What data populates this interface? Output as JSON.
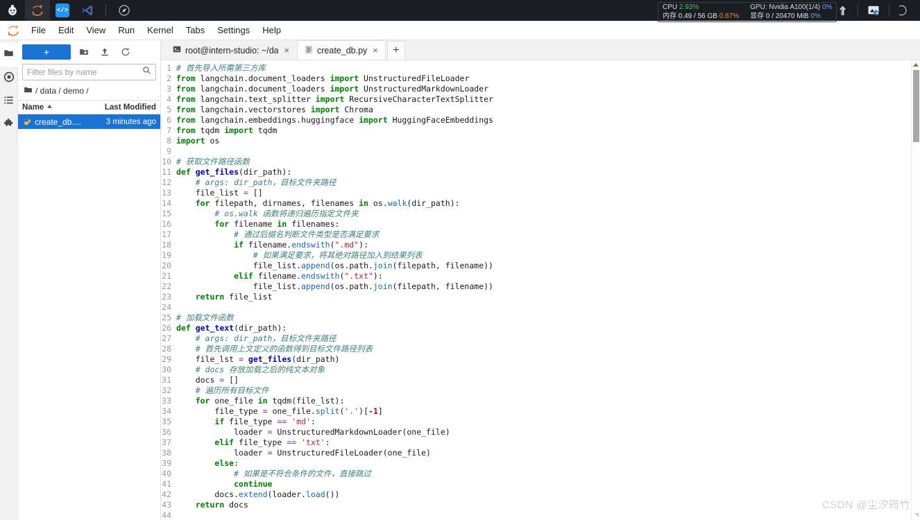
{
  "topbar": {
    "apps": [
      {
        "name": "studio-logo-icon",
        "label": ""
      },
      {
        "name": "jupyter-app-icon",
        "label": ""
      },
      {
        "name": "code-app-icon",
        "label": "</>"
      },
      {
        "name": "vscode-app-icon",
        "label": ""
      },
      {
        "name": "compass-app-icon",
        "label": ""
      }
    ],
    "stats": {
      "cpu_label": "CPU",
      "cpu_value": "2.93%",
      "mem_label": "内存",
      "mem_value": "0.49 / 56 GB",
      "mem_pct": "0.87%",
      "gpu_label": "GPU: Nvidia A100(1/4)",
      "gpu_pct": "0%",
      "vram_label": "显存",
      "vram_value": "0 / 20470 MiB",
      "vram_pct": "0%"
    },
    "right_icons": [
      {
        "name": "upload-arrow-icon"
      },
      {
        "name": "image-share-icon"
      },
      {
        "name": "more-icon"
      }
    ],
    "colors": {
      "background": "#1b1d23",
      "green": "#49c46a",
      "orange": "#e8923a",
      "blue": "#5aa9f0"
    }
  },
  "menubar": {
    "logo_name": "jupyter-logo-icon",
    "items": [
      {
        "label": "File"
      },
      {
        "label": "Edit"
      },
      {
        "label": "View"
      },
      {
        "label": "Run"
      },
      {
        "label": "Kernel"
      },
      {
        "label": "Tabs"
      },
      {
        "label": "Settings"
      },
      {
        "label": "Help"
      }
    ]
  },
  "rail": {
    "items": [
      {
        "name": "sidebar-item-file-browser",
        "icon": "folder-icon",
        "active": true
      },
      {
        "name": "sidebar-item-running",
        "icon": "running-stop-icon",
        "active": false
      },
      {
        "name": "sidebar-item-commands",
        "icon": "list-icon",
        "active": false
      },
      {
        "name": "sidebar-item-extensions",
        "icon": "puzzle-icon",
        "active": false
      }
    ]
  },
  "filebrowser": {
    "new_button_label": "+",
    "toolbar_icons": [
      {
        "name": "new-folder-icon"
      },
      {
        "name": "upload-icon"
      },
      {
        "name": "refresh-icon"
      }
    ],
    "filter_placeholder": "Filter files by name",
    "filter_value": "",
    "search_icon": "search-icon",
    "breadcrumb": "/ data / demo /",
    "breadcrumb_icon": "folder-icon",
    "columns": {
      "name": "Name",
      "modified": "Last Modified",
      "sort_icon": "sort-asc-icon"
    },
    "rows": [
      {
        "icon": "python-file-icon",
        "name": "create_db....",
        "modified": "3 minutes ago",
        "selected": true
      }
    ]
  },
  "tabbar": {
    "tabs": [
      {
        "label": "root@intern-studio: ~/dat",
        "icon": "terminal-icon",
        "active": false,
        "close": "×"
      },
      {
        "label": "create_db.py",
        "icon": "text-file-icon",
        "active": true,
        "close": "×"
      }
    ],
    "add_label": "+"
  },
  "editor": {
    "scrollbar": {
      "name": "vertical-scrollbar"
    },
    "lines": [
      {
        "n": 1,
        "tokens": [
          {
            "t": "# 首先导入所需第三方库",
            "c": "cm"
          }
        ]
      },
      {
        "n": 2,
        "tokens": [
          {
            "t": "from",
            "c": "k"
          },
          {
            "t": " langchain.document_loaders "
          },
          {
            "t": "import",
            "c": "k"
          },
          {
            "t": " UnstructuredFileLoader"
          }
        ]
      },
      {
        "n": 3,
        "tokens": [
          {
            "t": "from",
            "c": "k"
          },
          {
            "t": " langchain.document_loaders "
          },
          {
            "t": "import",
            "c": "k"
          },
          {
            "t": " UnstructuredMarkdownLoader"
          }
        ]
      },
      {
        "n": 4,
        "tokens": [
          {
            "t": "from",
            "c": "k"
          },
          {
            "t": " langchain.text_splitter "
          },
          {
            "t": "import",
            "c": "k"
          },
          {
            "t": " RecursiveCharacterTextSplitter"
          }
        ]
      },
      {
        "n": 5,
        "tokens": [
          {
            "t": "from",
            "c": "k"
          },
          {
            "t": " langchain.vectorstores "
          },
          {
            "t": "import",
            "c": "k"
          },
          {
            "t": " Chroma"
          }
        ]
      },
      {
        "n": 6,
        "tokens": [
          {
            "t": "from",
            "c": "k"
          },
          {
            "t": " langchain.embeddings.huggingface "
          },
          {
            "t": "import",
            "c": "k"
          },
          {
            "t": " HuggingFaceEmbeddings"
          }
        ]
      },
      {
        "n": 7,
        "tokens": [
          {
            "t": "from",
            "c": "k"
          },
          {
            "t": " tqdm "
          },
          {
            "t": "import",
            "c": "k"
          },
          {
            "t": " tqdm"
          }
        ]
      },
      {
        "n": 8,
        "tokens": [
          {
            "t": "import",
            "c": "k"
          },
          {
            "t": " os"
          }
        ]
      },
      {
        "n": 9,
        "tokens": []
      },
      {
        "n": 10,
        "tokens": [
          {
            "t": "# 获取文件路径函数",
            "c": "cm"
          }
        ]
      },
      {
        "n": 11,
        "tokens": [
          {
            "t": "def",
            "c": "k"
          },
          {
            "t": " "
          },
          {
            "t": "get_files",
            "c": "fn"
          },
          {
            "t": "(dir_path):"
          }
        ]
      },
      {
        "n": 12,
        "tokens": [
          {
            "t": "    # args: dir_path，目标文件夹路径",
            "c": "cm"
          }
        ]
      },
      {
        "n": 13,
        "tokens": [
          {
            "t": "    file_list "
          },
          {
            "t": "=",
            "c": "op"
          },
          {
            "t": " []"
          }
        ]
      },
      {
        "n": 14,
        "tokens": [
          {
            "t": "    "
          },
          {
            "t": "for",
            "c": "k"
          },
          {
            "t": " filepath, dirnames, filenames "
          },
          {
            "t": "in",
            "c": "k"
          },
          {
            "t": " os."
          },
          {
            "t": "walk",
            "c": "mt"
          },
          {
            "t": "(dir_path):"
          }
        ]
      },
      {
        "n": 15,
        "tokens": [
          {
            "t": "        # os.walk 函数将递归遍历指定文件夹",
            "c": "cm"
          }
        ]
      },
      {
        "n": 16,
        "tokens": [
          {
            "t": "        "
          },
          {
            "t": "for",
            "c": "k"
          },
          {
            "t": " filename "
          },
          {
            "t": "in",
            "c": "k"
          },
          {
            "t": " filenames:"
          }
        ]
      },
      {
        "n": 17,
        "tokens": [
          {
            "t": "            # 通过后缀名判断文件类型是否满足要求",
            "c": "cm"
          }
        ]
      },
      {
        "n": 18,
        "tokens": [
          {
            "t": "            "
          },
          {
            "t": "if",
            "c": "k"
          },
          {
            "t": " filename."
          },
          {
            "t": "endswith",
            "c": "mt"
          },
          {
            "t": "("
          },
          {
            "t": "\".md\"",
            "c": "st"
          },
          {
            "t": "):"
          }
        ]
      },
      {
        "n": 19,
        "tokens": [
          {
            "t": "                # 如果满足要求，将其绝对路径加入到结果列表",
            "c": "cm"
          }
        ]
      },
      {
        "n": 20,
        "tokens": [
          {
            "t": "                file_list."
          },
          {
            "t": "append",
            "c": "mt"
          },
          {
            "t": "(os.path."
          },
          {
            "t": "join",
            "c": "mt"
          },
          {
            "t": "(filepath, filename))"
          }
        ]
      },
      {
        "n": 21,
        "tokens": [
          {
            "t": "            "
          },
          {
            "t": "elif",
            "c": "k"
          },
          {
            "t": " filename."
          },
          {
            "t": "endswith",
            "c": "mt"
          },
          {
            "t": "("
          },
          {
            "t": "\".txt\"",
            "c": "st"
          },
          {
            "t": "):"
          }
        ]
      },
      {
        "n": 22,
        "tokens": [
          {
            "t": "                file_list."
          },
          {
            "t": "append",
            "c": "mt"
          },
          {
            "t": "(os.path."
          },
          {
            "t": "join",
            "c": "mt"
          },
          {
            "t": "(filepath, filename))"
          }
        ]
      },
      {
        "n": 23,
        "tokens": [
          {
            "t": "    "
          },
          {
            "t": "return",
            "c": "k"
          },
          {
            "t": " file_list"
          }
        ]
      },
      {
        "n": 24,
        "tokens": []
      },
      {
        "n": 25,
        "tokens": [
          {
            "t": "# 加载文件函数",
            "c": "cm"
          }
        ]
      },
      {
        "n": 26,
        "tokens": [
          {
            "t": "def",
            "c": "k"
          },
          {
            "t": " "
          },
          {
            "t": "get_text",
            "c": "fn"
          },
          {
            "t": "(dir_path):"
          }
        ]
      },
      {
        "n": 27,
        "tokens": [
          {
            "t": "    # args: dir_path，目标文件夹路径",
            "c": "cm"
          }
        ]
      },
      {
        "n": 28,
        "tokens": [
          {
            "t": "    # 首先调用上文定义的函数得到目标文件路径列表",
            "c": "cm"
          }
        ]
      },
      {
        "n": 29,
        "tokens": [
          {
            "t": "    file_lst "
          },
          {
            "t": "=",
            "c": "op"
          },
          {
            "t": " "
          },
          {
            "t": "get_files",
            "c": "fn"
          },
          {
            "t": "(dir_path)"
          }
        ]
      },
      {
        "n": 30,
        "tokens": [
          {
            "t": "    # docs 存放加载之后的纯文本对象",
            "c": "cm"
          }
        ]
      },
      {
        "n": 31,
        "tokens": [
          {
            "t": "    docs "
          },
          {
            "t": "=",
            "c": "op"
          },
          {
            "t": " []"
          }
        ]
      },
      {
        "n": 32,
        "tokens": [
          {
            "t": "    # 遍历所有目标文件",
            "c": "cm"
          }
        ]
      },
      {
        "n": 33,
        "tokens": [
          {
            "t": "    "
          },
          {
            "t": "for",
            "c": "k"
          },
          {
            "t": " one_file "
          },
          {
            "t": "in",
            "c": "k"
          },
          {
            "t": " tqdm(file_lst):"
          }
        ]
      },
      {
        "n": 34,
        "tokens": [
          {
            "t": "        file_type "
          },
          {
            "t": "=",
            "c": "op"
          },
          {
            "t": " one_file."
          },
          {
            "t": "split",
            "c": "mt"
          },
          {
            "t": "("
          },
          {
            "t": "'.'",
            "c": "st"
          },
          {
            "t": ")["
          },
          {
            "t": "-1",
            "c": "nu"
          },
          {
            "t": "]"
          }
        ]
      },
      {
        "n": 35,
        "tokens": [
          {
            "t": "        "
          },
          {
            "t": "if",
            "c": "k"
          },
          {
            "t": " file_type "
          },
          {
            "t": "==",
            "c": "op"
          },
          {
            "t": " "
          },
          {
            "t": "'md'",
            "c": "st"
          },
          {
            "t": ":"
          }
        ]
      },
      {
        "n": 36,
        "tokens": [
          {
            "t": "            loader "
          },
          {
            "t": "=",
            "c": "op"
          },
          {
            "t": " UnstructuredMarkdownLoader(one_file)"
          }
        ]
      },
      {
        "n": 37,
        "tokens": [
          {
            "t": "        "
          },
          {
            "t": "elif",
            "c": "k"
          },
          {
            "t": " file_type "
          },
          {
            "t": "==",
            "c": "op"
          },
          {
            "t": " "
          },
          {
            "t": "'txt'",
            "c": "st"
          },
          {
            "t": ":"
          }
        ]
      },
      {
        "n": 38,
        "tokens": [
          {
            "t": "            loader "
          },
          {
            "t": "=",
            "c": "op"
          },
          {
            "t": " UnstructuredFileLoader(one_file)"
          }
        ]
      },
      {
        "n": 39,
        "tokens": [
          {
            "t": "        "
          },
          {
            "t": "else",
            "c": "k"
          },
          {
            "t": ":"
          }
        ]
      },
      {
        "n": 40,
        "tokens": [
          {
            "t": "            # 如果是不符合条件的文件，直接跳过",
            "c": "cm"
          }
        ]
      },
      {
        "n": 41,
        "tokens": [
          {
            "t": "            "
          },
          {
            "t": "continue",
            "c": "k"
          }
        ]
      },
      {
        "n": 42,
        "tokens": [
          {
            "t": "        docs."
          },
          {
            "t": "extend",
            "c": "mt"
          },
          {
            "t": "(loader."
          },
          {
            "t": "load",
            "c": "mt"
          },
          {
            "t": "())"
          }
        ]
      },
      {
        "n": 43,
        "tokens": [
          {
            "t": "    "
          },
          {
            "t": "return",
            "c": "k"
          },
          {
            "t": " docs"
          }
        ]
      },
      {
        "n": 44,
        "tokens": []
      }
    ]
  },
  "watermark": "CSDN @尘汐筠竹"
}
